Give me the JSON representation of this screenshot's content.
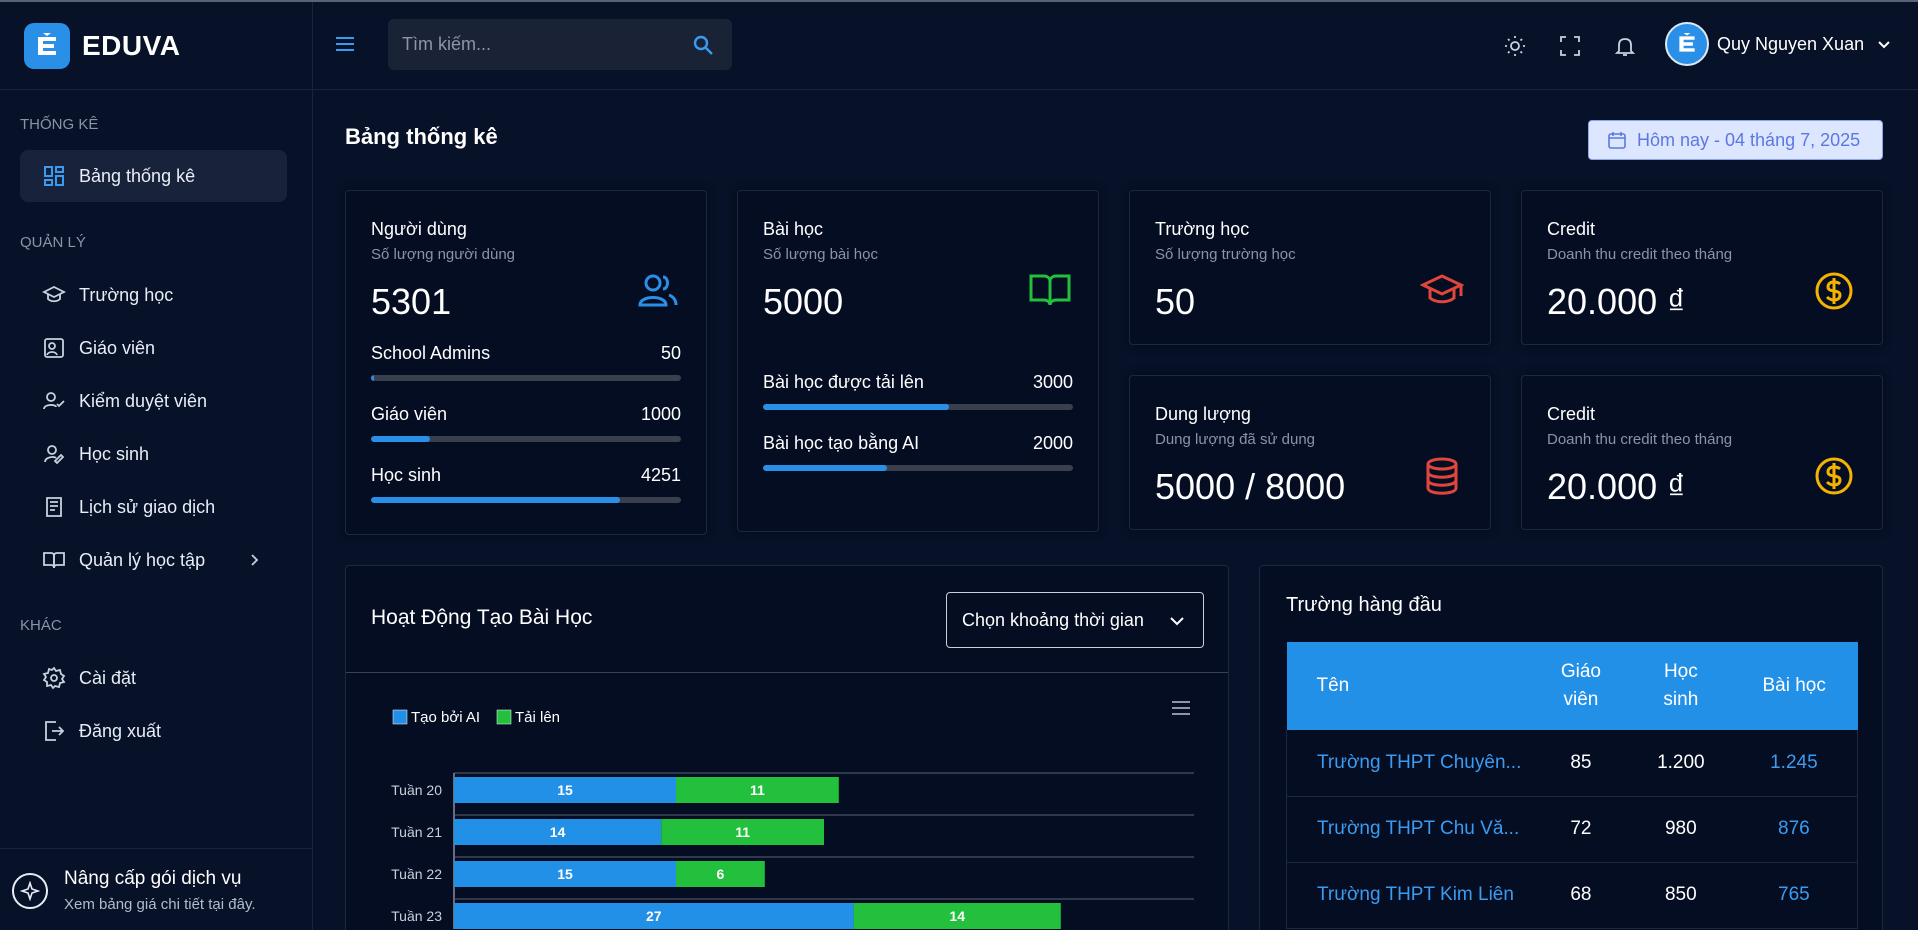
{
  "app": {
    "name": "EDUVA"
  },
  "sidebar": {
    "sections": [
      {
        "label": "THỐNG KÊ"
      },
      {
        "label": "QUẢN LÝ"
      },
      {
        "label": "KHÁC"
      }
    ],
    "items": [
      {
        "label": "Bảng thống kê",
        "icon": "dashboard-icon",
        "active": true
      },
      {
        "label": "Trường học",
        "icon": "graduation-cap-icon"
      },
      {
        "label": "Giáo viên",
        "icon": "teacher-icon"
      },
      {
        "label": "Kiểm duyệt viên",
        "icon": "user-check-icon"
      },
      {
        "label": "Học sinh",
        "icon": "student-icon"
      },
      {
        "label": "Lịch sử giao dịch",
        "icon": "receipt-icon"
      },
      {
        "label": "Quản lý học tập",
        "icon": "book-open-icon"
      },
      {
        "label": "Cài đặt",
        "icon": "gear-icon"
      },
      {
        "label": "Đăng xuất",
        "icon": "logout-icon"
      }
    ],
    "upgrade": {
      "title": "Nâng cấp gói dịch vụ",
      "subtitle": "Xem bảng giá chi tiết tại đây."
    }
  },
  "header": {
    "search_placeholder": "Tìm kiếm...",
    "user_name": "Quy Nguyen Xuan"
  },
  "main": {
    "title": "Bảng thống kê",
    "date_label": "Hôm nay - 04 tháng 7, 2025",
    "cards": {
      "users": {
        "title": "Người dùng",
        "subtitle": "Số lượng người dùng",
        "value": "5301",
        "rows": [
          {
            "label": "School Admins",
            "value": "50",
            "fraction": 0.0094
          },
          {
            "label": "Giáo viên",
            "value": "1000",
            "fraction": 0.189
          },
          {
            "label": "Học sinh",
            "value": "4251",
            "fraction": 0.802
          }
        ]
      },
      "lessons": {
        "title": "Bài học",
        "subtitle": "Số lượng bài học",
        "value": "5000",
        "rows": [
          {
            "label": "Bài học được tải lên",
            "value": "3000",
            "fraction": 0.6
          },
          {
            "label": "Bài học tạo bằng AI",
            "value": "2000",
            "fraction": 0.4
          }
        ]
      },
      "schools": {
        "title": "Trường học",
        "subtitle": "Số lượng trường học",
        "value": "50"
      },
      "credit1": {
        "title": "Credit",
        "subtitle": "Doanh thu credit theo tháng",
        "value": "20.000 ₫"
      },
      "storage": {
        "title": "Dung lượng",
        "subtitle": "Dung lượng đã sử dụng",
        "value": "5000 / 8000"
      },
      "credit2": {
        "title": "Credit",
        "subtitle": "Doanh thu credit theo tháng",
        "value": "20.000 ₫"
      }
    },
    "activity": {
      "title": "Hoạt Động Tạo Bài Học",
      "range_select": "Chọn khoảng thời gian"
    },
    "top_schools": {
      "title": "Trường hàng đầu",
      "headers": {
        "name": "Tên",
        "teachers": "Giáo viên",
        "students": "Học sinh",
        "lessons": "Bài học"
      },
      "rows": [
        {
          "name": "Trường THPT Chuyên...",
          "teachers": "85",
          "students": "1.200",
          "lessons": "1.245"
        },
        {
          "name": "Trường THPT Chu Vă...",
          "teachers": "72",
          "students": "980",
          "lessons": "876"
        },
        {
          "name": "Trường THPT Kim Liên",
          "teachers": "68",
          "students": "850",
          "lessons": "765"
        }
      ]
    }
  },
  "colors": {
    "accent": "#2a8fe6",
    "green": "#22c03c",
    "red": "#e0463c",
    "gold": "#f5b301",
    "background": "#071127"
  },
  "chart_data": {
    "type": "bar",
    "orientation": "horizontal",
    "stacked": true,
    "categories": [
      "Tuần 20",
      "Tuần 21",
      "Tuần 22",
      "Tuần 23"
    ],
    "series": [
      {
        "name": "Tạo bởi AI",
        "values": [
          15,
          14,
          15,
          27
        ],
        "color": "#2390e8"
      },
      {
        "name": "Tải lên",
        "values": [
          11,
          11,
          6,
          14
        ],
        "color": "#22c03c"
      }
    ],
    "xlim": [
      0,
      50
    ],
    "legend": "top-left",
    "grid": true
  }
}
